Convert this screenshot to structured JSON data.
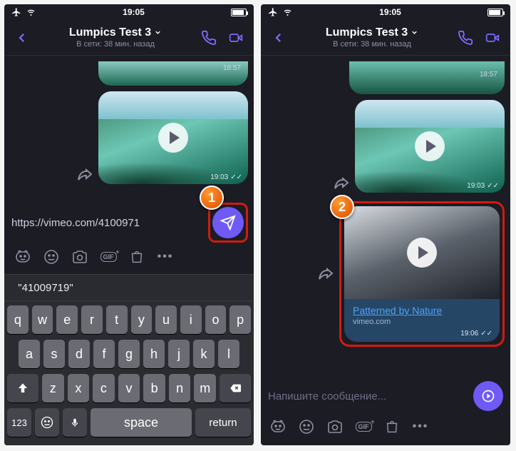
{
  "status": {
    "time": "19:05"
  },
  "header": {
    "title": "Lumpics Test 3",
    "subtitle": "В сети: 38 мин. назад"
  },
  "left": {
    "prev_msg_time": "18:57",
    "video_time": "19:03",
    "input_value": "https://vimeo.com/4100971",
    "suggestion": "\"41009719\"",
    "step": "1"
  },
  "right": {
    "prev_time_top": "18:57",
    "video_time": "19:03",
    "card": {
      "title": "Patterned by Nature",
      "domain": "vimeo.com",
      "time": "19:06"
    },
    "placeholder": "Напишите сообщение...",
    "step": "2"
  },
  "keyboard": {
    "row1": [
      "q",
      "w",
      "e",
      "r",
      "t",
      "y",
      "u",
      "i",
      "o",
      "p"
    ],
    "row2": [
      "a",
      "s",
      "d",
      "f",
      "g",
      "h",
      "j",
      "k",
      "l"
    ],
    "num": "123",
    "space": "space",
    "return": "return"
  }
}
